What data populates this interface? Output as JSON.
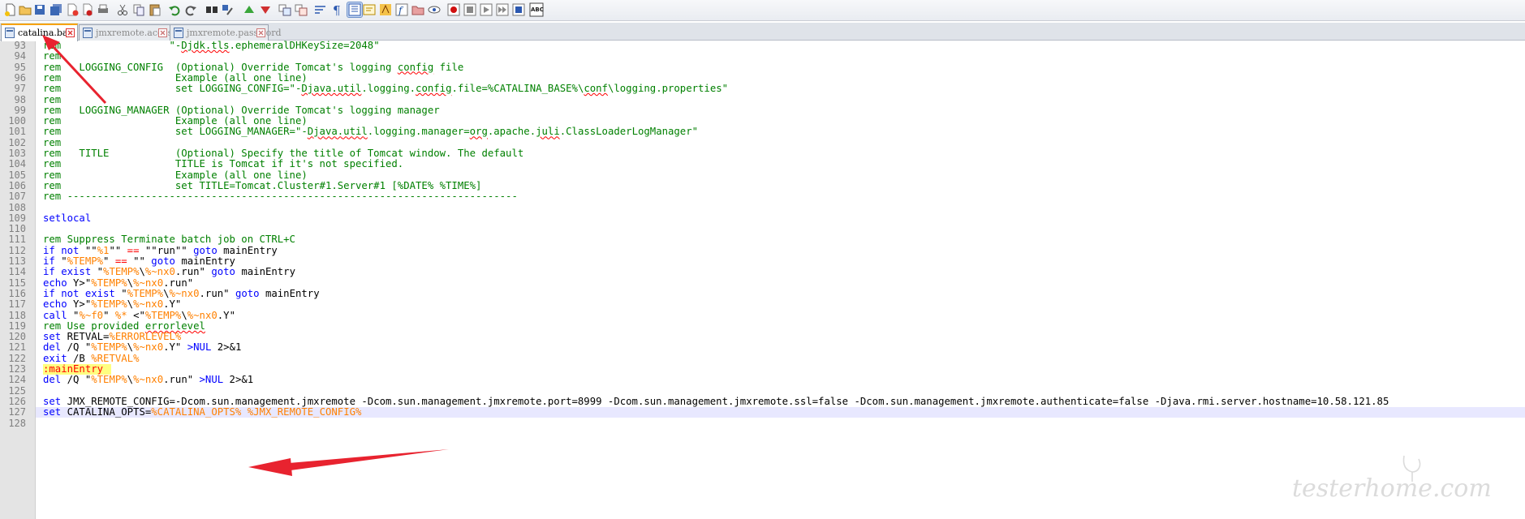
{
  "toolbar": {
    "icons": [
      "new-file-icon",
      "open-file-icon",
      "save-icon",
      "save-all-icon",
      "close-icon",
      "close-all-icon",
      "print-icon",
      "cut-icon",
      "copy-icon",
      "paste-icon",
      "undo-icon",
      "redo-icon",
      "find-icon",
      "replace-icon",
      "zoom-in-icon",
      "zoom-out-icon",
      "sync-vertical-icon",
      "sync-horizontal-icon",
      "word-wrap-icon",
      "show-all-chars-icon",
      "indent-guide-icon",
      "user-lang-icon",
      "doc-map-icon",
      "function-list-icon",
      "folder-workspace-icon",
      "monitor-icon",
      "record-macro-icon",
      "stop-record-icon",
      "play-macro-icon",
      "run-macro-multiple-icon",
      "save-macro-icon",
      "spell-check-icon"
    ],
    "spell_label": "ABC"
  },
  "tabs": [
    {
      "label": "catalina.bat",
      "active": true
    },
    {
      "label": "jmxremote.access",
      "active": false
    },
    {
      "label": "jmxremote.password",
      "active": false
    }
  ],
  "colors": {
    "comment": "#008000",
    "keyword": "#0000ff",
    "variable": "#ff8000",
    "operator": "#ff0000",
    "arrow": "#e8232f"
  },
  "lines": [
    {
      "n": "93",
      "segs": [
        [
          "c",
          "rem                  \"-"
        ],
        [
          "c sq",
          "Djdk.tls"
        ],
        [
          "c",
          ".ephemeralDHKeySize=2048\""
        ]
      ]
    },
    {
      "n": "94",
      "segs": [
        [
          "c",
          "rem"
        ]
      ]
    },
    {
      "n": "95",
      "segs": [
        [
          "c",
          "rem   LOGGING_CONFIG  (Optional) Override Tomcat's logging "
        ],
        [
          "c sq",
          "config"
        ],
        [
          "c",
          " file"
        ]
      ]
    },
    {
      "n": "96",
      "segs": [
        [
          "c",
          "rem                   Example (all one line)"
        ]
      ]
    },
    {
      "n": "97",
      "segs": [
        [
          "c",
          "rem                   set LOGGING_CONFIG=\"-"
        ],
        [
          "c sq",
          "Djava.util"
        ],
        [
          "c",
          ".logging."
        ],
        [
          "c sq",
          "config"
        ],
        [
          "c",
          ".file=%CATALINA_BASE%\\"
        ],
        [
          "c sq",
          "conf"
        ],
        [
          "c",
          "\\logging.properties\""
        ]
      ]
    },
    {
      "n": "98",
      "segs": [
        [
          "c",
          "rem"
        ]
      ]
    },
    {
      "n": "99",
      "segs": [
        [
          "c",
          "rem   LOGGING_MANAGER (Optional) Override Tomcat's logging manager"
        ]
      ]
    },
    {
      "n": "100",
      "segs": [
        [
          "c",
          "rem                   Example (all one line)"
        ]
      ]
    },
    {
      "n": "101",
      "segs": [
        [
          "c",
          "rem                   set LOGGING_MANAGER=\"-"
        ],
        [
          "c sq",
          "Djava.util"
        ],
        [
          "c",
          ".logging.manager="
        ],
        [
          "c sq",
          "org"
        ],
        [
          "c",
          ".apache."
        ],
        [
          "c sq",
          "juli"
        ],
        [
          "c",
          ".ClassLoaderLogManager\""
        ]
      ]
    },
    {
      "n": "102",
      "segs": [
        [
          "c",
          "rem"
        ]
      ]
    },
    {
      "n": "103",
      "segs": [
        [
          "c",
          "rem   TITLE           (Optional) Specify the title of Tomcat window. The default"
        ]
      ]
    },
    {
      "n": "104",
      "segs": [
        [
          "c",
          "rem                   TITLE is Tomcat if it's not specified."
        ]
      ]
    },
    {
      "n": "105",
      "segs": [
        [
          "c",
          "rem                   Example (all one line)"
        ]
      ]
    },
    {
      "n": "106",
      "segs": [
        [
          "c",
          "rem                   set TITLE=Tomcat.Cluster#1.Server#1 [%DATE% %TIME%]"
        ]
      ]
    },
    {
      "n": "107",
      "segs": [
        [
          "c",
          "rem ---------------------------------------------------------------------------"
        ]
      ]
    },
    {
      "n": "108",
      "segs": []
    },
    {
      "n": "109",
      "segs": [
        [
          "k",
          "setlocal"
        ]
      ]
    },
    {
      "n": "110",
      "segs": []
    },
    {
      "n": "111",
      "segs": [
        [
          "c",
          "rem Suppress Terminate batch job on CTRL+C"
        ]
      ]
    },
    {
      "n": "112",
      "segs": [
        [
          "k",
          "if not"
        ],
        [
          "t",
          " \"\""
        ],
        [
          "v",
          "%1"
        ],
        [
          "t",
          "\"\" "
        ],
        [
          "o",
          "=="
        ],
        [
          "t",
          " \"\"run\"\" "
        ],
        [
          "k",
          "goto"
        ],
        [
          "t",
          " mainEntry"
        ]
      ]
    },
    {
      "n": "113",
      "segs": [
        [
          "k",
          "if"
        ],
        [
          "t",
          " \""
        ],
        [
          "v",
          "%TEMP%"
        ],
        [
          "t",
          "\" "
        ],
        [
          "o",
          "=="
        ],
        [
          "t",
          " \"\" "
        ],
        [
          "k",
          "goto"
        ],
        [
          "t",
          " mainEntry"
        ]
      ]
    },
    {
      "n": "114",
      "segs": [
        [
          "k",
          "if exist"
        ],
        [
          "t",
          " \""
        ],
        [
          "v",
          "%TEMP%"
        ],
        [
          "t",
          "\\"
        ],
        [
          "v",
          "%~nx0"
        ],
        [
          "t",
          ".run\" "
        ],
        [
          "k",
          "goto"
        ],
        [
          "t",
          " mainEntry"
        ]
      ]
    },
    {
      "n": "115",
      "segs": [
        [
          "k",
          "echo"
        ],
        [
          "t",
          " Y>\""
        ],
        [
          "v",
          "%TEMP%"
        ],
        [
          "t",
          "\\"
        ],
        [
          "v",
          "%~nx0"
        ],
        [
          "t",
          ".run\""
        ]
      ]
    },
    {
      "n": "116",
      "segs": [
        [
          "k",
          "if not exist"
        ],
        [
          "t",
          " \""
        ],
        [
          "v",
          "%TEMP%"
        ],
        [
          "t",
          "\\"
        ],
        [
          "v",
          "%~nx0"
        ],
        [
          "t",
          ".run\" "
        ],
        [
          "k",
          "goto"
        ],
        [
          "t",
          " mainEntry"
        ]
      ]
    },
    {
      "n": "117",
      "segs": [
        [
          "k",
          "echo"
        ],
        [
          "t",
          " Y>\""
        ],
        [
          "v",
          "%TEMP%"
        ],
        [
          "t",
          "\\"
        ],
        [
          "v",
          "%~nx0"
        ],
        [
          "t",
          ".Y\""
        ]
      ]
    },
    {
      "n": "118",
      "segs": [
        [
          "k",
          "call"
        ],
        [
          "t",
          " \""
        ],
        [
          "v",
          "%~f0"
        ],
        [
          "t",
          "\" "
        ],
        [
          "v",
          "%*"
        ],
        [
          "t",
          " <\""
        ],
        [
          "v",
          "%TEMP%"
        ],
        [
          "t",
          "\\"
        ],
        [
          "v",
          "%~nx0"
        ],
        [
          "t",
          ".Y\""
        ]
      ]
    },
    {
      "n": "119",
      "segs": [
        [
          "c",
          "rem Use provided "
        ],
        [
          "c sq",
          "errorlevel"
        ]
      ]
    },
    {
      "n": "120",
      "segs": [
        [
          "k",
          "set"
        ],
        [
          "t",
          " RETVAL="
        ],
        [
          "v",
          "%ERRORLEVEL%"
        ]
      ]
    },
    {
      "n": "121",
      "segs": [
        [
          "k",
          "del"
        ],
        [
          "t",
          " /Q \""
        ],
        [
          "v",
          "%TEMP%"
        ],
        [
          "t",
          "\\"
        ],
        [
          "v",
          "%~nx0"
        ],
        [
          "t",
          ".Y\" "
        ],
        [
          "k",
          ">NUL"
        ],
        [
          "t",
          " 2>&1"
        ]
      ]
    },
    {
      "n": "122",
      "segs": [
        [
          "k",
          "exit"
        ],
        [
          "t",
          " /B "
        ],
        [
          "v",
          "%RETVAL%"
        ]
      ]
    },
    {
      "n": "123",
      "segs": [
        [
          "lbl",
          ":mainEntry"
        ]
      ]
    },
    {
      "n": "124",
      "segs": [
        [
          "k",
          "del"
        ],
        [
          "t",
          " /Q \""
        ],
        [
          "v",
          "%TEMP%"
        ],
        [
          "t",
          "\\"
        ],
        [
          "v",
          "%~nx0"
        ],
        [
          "t",
          ".run\" "
        ],
        [
          "k",
          ">NUL"
        ],
        [
          "t",
          " 2>&1"
        ]
      ]
    },
    {
      "n": "125",
      "segs": []
    },
    {
      "n": "126",
      "segs": [
        [
          "k",
          "set"
        ],
        [
          "t",
          " JMX_REMOTE_CONFIG=-Dcom.sun.management.jmxremote -Dcom.sun.management.jmxremote.port=8999 -Dcom.sun.management.jmxremote.ssl=false -Dcom.sun.management.jmxremote.authenticate=false -Djava.rmi.server.hostname=10.58.121.85"
        ]
      ]
    },
    {
      "n": "127",
      "segs": [
        [
          "k",
          "set"
        ],
        [
          "t",
          " CATALINA_OPTS="
        ],
        [
          "v",
          "%CATALINA_OPTS%"
        ],
        [
          "t",
          " "
        ],
        [
          "v",
          "%JMX_REMOTE_CONFIG%"
        ]
      ]
    },
    {
      "n": "128",
      "segs": []
    }
  ],
  "current_line": "127",
  "watermark": "testerhome.com"
}
